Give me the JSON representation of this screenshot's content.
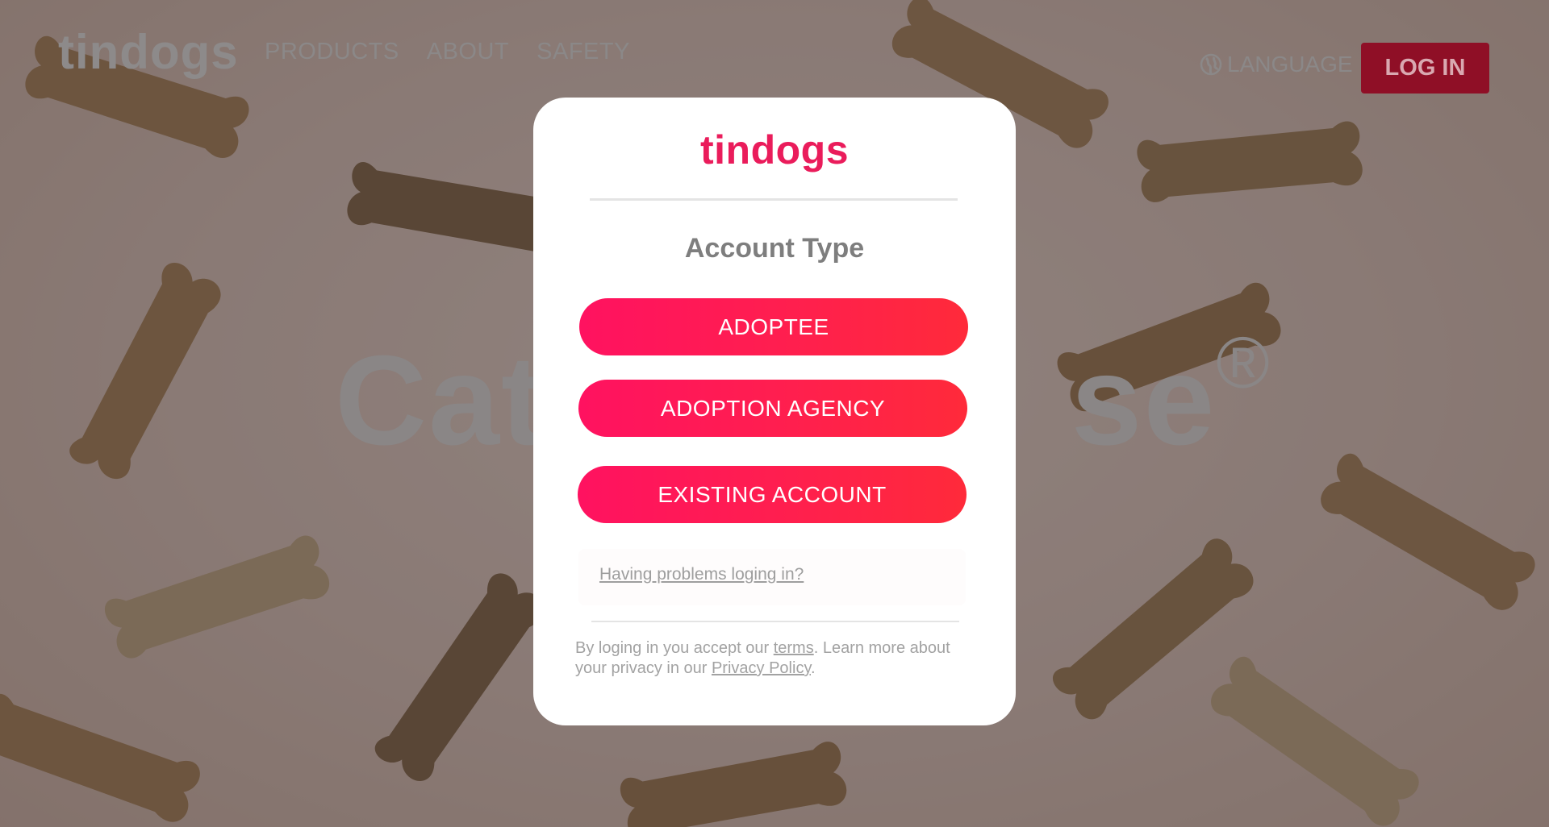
{
  "nav": {
    "logo": "tindogs",
    "links": [
      "PRODUCTS",
      "ABOUT",
      "SAFETY"
    ],
    "language_label": "LANGUAGE",
    "login_label": "LOG IN"
  },
  "hero": {
    "left_text": "Cat",
    "right_text": "se",
    "mark": "®"
  },
  "modal": {
    "logo": "tindogs",
    "title": "Account Type",
    "buttons": [
      "ADOPTEE",
      "ADOPTION AGENCY",
      "EXISTING ACCOUNT"
    ],
    "help_link": "Having problems loging in?",
    "legal": {
      "prefix": "By loging in you accept our ",
      "terms": "terms",
      "middle": ". Learn more about your privacy in our ",
      "privacy": "Privacy Policy",
      "suffix": "."
    }
  },
  "colors": {
    "accent": "#ff1f4e",
    "logo": "#ea1c5b",
    "login_bg": "#8f0f26"
  },
  "icons": {
    "language": "globe-icon"
  }
}
